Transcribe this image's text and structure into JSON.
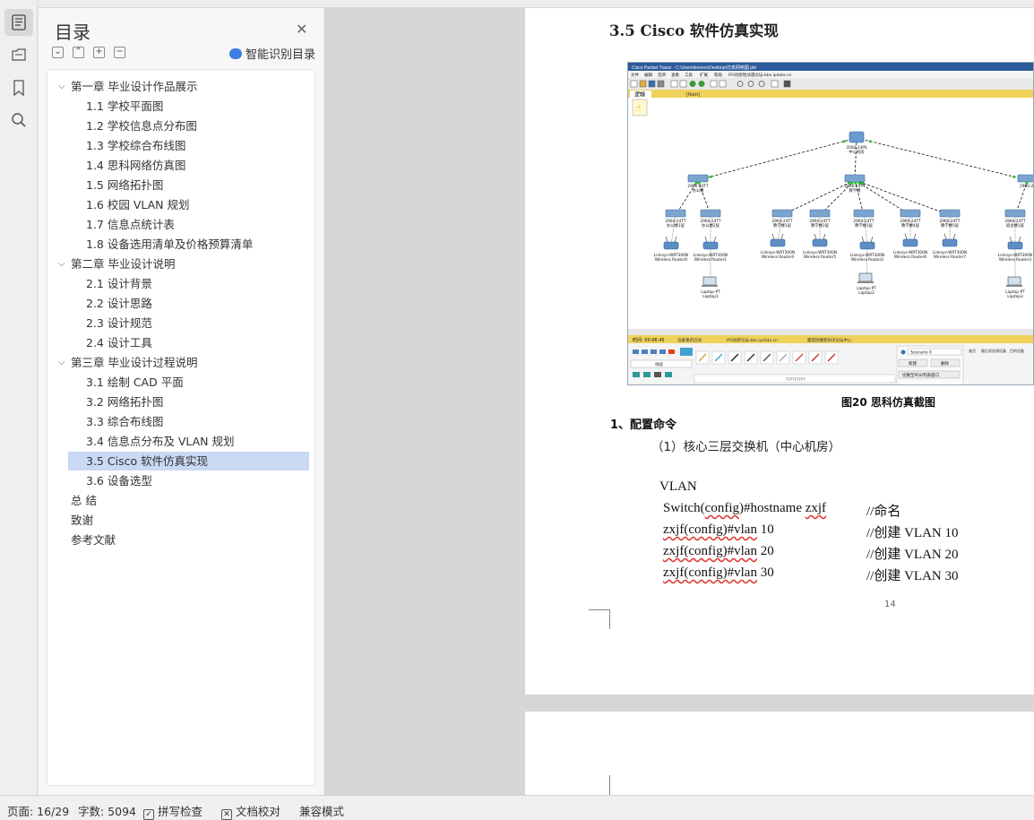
{
  "toc": {
    "title": "目录",
    "smart_label": "智能识别目录",
    "items": [
      {
        "label": "第一章  毕业设计作品展示",
        "level": 1,
        "expanded": true
      },
      {
        "label": "1.1  学校平面图",
        "level": 2
      },
      {
        "label": "1.2  学校信息点分布图",
        "level": 2
      },
      {
        "label": "1.3  学校综合布线图",
        "level": 2
      },
      {
        "label": "1.4  思科网络仿真图",
        "level": 2
      },
      {
        "label": "1.5  网络拓扑图",
        "level": 2
      },
      {
        "label": "1.6  校园 VLAN 规划",
        "level": 2
      },
      {
        "label": "1.7  信息点统计表",
        "level": 2
      },
      {
        "label": "1.8  设备选用清单及价格预算清单",
        "level": 2
      },
      {
        "label": "第二章  毕业设计说明",
        "level": 1,
        "expanded": true
      },
      {
        "label": "2.1  设计背景",
        "level": 2
      },
      {
        "label": "2.2  设计思路",
        "level": 2
      },
      {
        "label": "2.3  设计规范",
        "level": 2
      },
      {
        "label": "2.4  设计工具",
        "level": 2
      },
      {
        "label": "第三章  毕业设计过程说明",
        "level": 1,
        "expanded": true
      },
      {
        "label": "3.1  绘制 CAD 平面",
        "level": 2
      },
      {
        "label": "3.2  网络拓扑图",
        "level": 2
      },
      {
        "label": "3.3  综合布线图",
        "level": 2
      },
      {
        "label": "3.4  信息点分布及 VLAN 规划",
        "level": 2
      },
      {
        "label": "3.5 Cisco 软件仿真实现",
        "level": 2,
        "selected": true
      },
      {
        "label": "3.6  设备选型",
        "level": 2
      },
      {
        "label": "总 结",
        "level": 1
      },
      {
        "label": "致谢",
        "level": 1
      },
      {
        "label": "参考文献",
        "level": 1
      }
    ]
  },
  "document": {
    "heading": "3.5 Cisco 软件仿真实现",
    "caption": "图20 思科仿真截图",
    "section": "1、配置命令",
    "subsection": "（1）核心三层交换机（中心机房）",
    "code_title": "VLAN",
    "code_lines": [
      {
        "cmd_pre": "Switch(",
        "cmd_sq": "config",
        "cmd_post": ")#hostname ",
        "cmd_sq2": "zxjf",
        "comment": "//命名"
      },
      {
        "cmd_pre": "",
        "cmd_sq": "zxjf(config)#vlan",
        "cmd_post": " 10",
        "cmd_sq2": "",
        "comment": "//创建 VLAN 10"
      },
      {
        "cmd_pre": "",
        "cmd_sq": "zxjf(config)#vlan",
        "cmd_post": " 20",
        "cmd_sq2": "",
        "comment": "//创建 VLAN 20"
      },
      {
        "cmd_pre": "",
        "cmd_sq": "zxjf(config)#vlan",
        "cmd_post": " 30",
        "cmd_sq2": "",
        "comment": "//创建 VLAN 30"
      }
    ],
    "page_number": "14"
  },
  "screenshot": {
    "window_title": "Cisco Packet Tracer - C:\\Users\\lenovo\\Desktop\\仿真网络图.pkt",
    "menu": [
      "文件",
      "编辑",
      "选项",
      "查看",
      "工具",
      "扩展",
      "帮助",
      "IP3创新性动漫论坛-bbs.ipdata.cn"
    ],
    "tab_logic": "逻辑",
    "root_label": "[Root]",
    "time_label": "时间: 00:06:45",
    "status_text_1": "设备重新启动",
    "status_text_2": "IP3创新论坛-bbs.ipdata.cn",
    "status_text_3": "蘑菇街播客知识论坛中心",
    "scenario": "Scenario 0",
    "btn_new": "新建",
    "btn_delete": "删除",
    "btn_pdu": "切换至PDU列表窗口",
    "pdu_cols": [
      "激活",
      "最后状态",
      "源设备",
      "目的设备"
    ],
    "devices_label": "线缆",
    "placeholder_text": "?????????",
    "core_label": "3560-24PS",
    "core_sub": "中心机房",
    "nodes": {
      "sw_left": {
        "l1": "2960-24TT",
        "l2": "办公楼"
      },
      "sw_mid": {
        "l1": "2960-24TT",
        "l2": "教学楼"
      },
      "sw_right": {
        "l1": "2960-24",
        "l2": ""
      },
      "a1": {
        "l1": "2960-24TT",
        "l2": "办公楼1层"
      },
      "a2": {
        "l1": "2960-24TT",
        "l2": "办公楼2层"
      },
      "a3": {
        "l1": "2960-24TT",
        "l2": "教学楼1层"
      },
      "a4": {
        "l1": "2960-24TT",
        "l2": "教学楼2层"
      },
      "a5": {
        "l1": "2960-24TT",
        "l2": "教学楼3层"
      },
      "a6": {
        "l1": "2960-24TT",
        "l2": "教学楼4层"
      },
      "a7": {
        "l1": "2960-24TT",
        "l2": "教学楼5层"
      },
      "a8": {
        "l1": "2960-24TT",
        "l2": "宿舍楼1层"
      },
      "r0": {
        "l1": "Linksys-WRT300N",
        "l2": "Wireless Router0"
      },
      "r1": {
        "l1": "Linksys-WRT300N",
        "l2": "Wireless Router1"
      },
      "r4": {
        "l1": "Linksys-WRT300N",
        "l2": "Wireless Router4"
      },
      "r5": {
        "l1": "Linksys-WRT300N",
        "l2": "Wireless Router5"
      },
      "r2": {
        "l1": "Linksys-WRT300N",
        "l2": "Wireless Router2"
      },
      "r6": {
        "l1": "Linksys-WRT300N",
        "l2": "Wireless Router6"
      },
      "r7": {
        "l1": "Linksys-WRT300N",
        "l2": "Wireless Router7"
      },
      "r3": {
        "l1": "Linksys-WRT300N",
        "l2": "Wireless Router3"
      },
      "lap1": {
        "l1": "Laptop-PT",
        "l2": "Laptop1"
      },
      "lap2": {
        "l1": "Laptop-PT",
        "l2": "Laptop2"
      },
      "lap3": {
        "l1": "Laptop-PT",
        "l2": "Laptop3"
      }
    }
  },
  "statusbar": {
    "page": "页面: 16/29",
    "words": "字数: 5094",
    "spell": "拼写检查",
    "proof": "文档校对",
    "compat": "兼容模式"
  },
  "colors": {
    "accent": "#3d7fe0",
    "selected_toc": "#c9d8f3",
    "squiggle": "#e03030",
    "pt_titlebar": "#2c5a9a",
    "pt_tabbar": "#f0d25a",
    "pt_link": "#1ec81e"
  }
}
